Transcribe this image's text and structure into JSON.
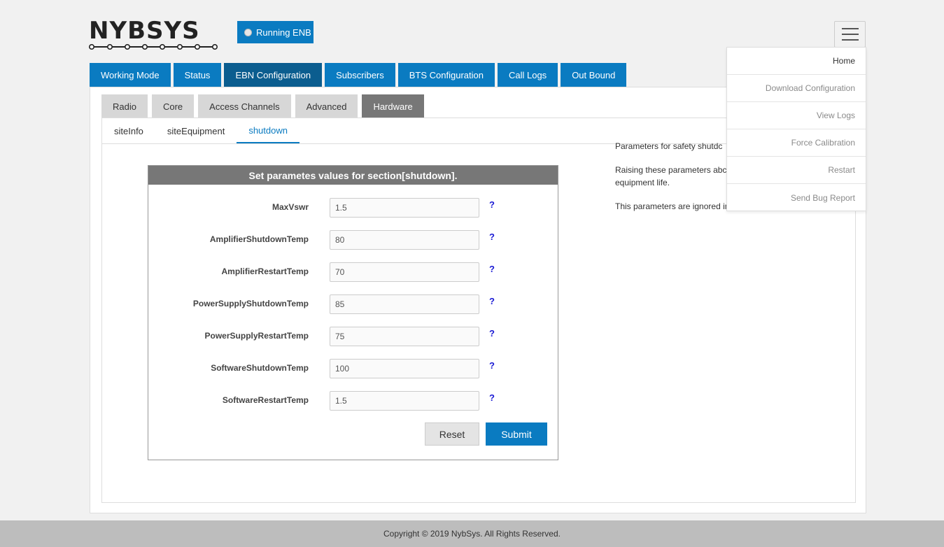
{
  "brand": {
    "logo_text": "NYBSYS"
  },
  "status": {
    "label": "Running ENB"
  },
  "main_tabs": [
    {
      "label": "Working Mode"
    },
    {
      "label": "Status"
    },
    {
      "label": "EBN Configuration"
    },
    {
      "label": "Subscribers"
    },
    {
      "label": "BTS Configuration"
    },
    {
      "label": "Call Logs"
    },
    {
      "label": "Out Bound"
    }
  ],
  "sub_tabs": [
    {
      "label": "Radio"
    },
    {
      "label": "Core"
    },
    {
      "label": "Access Channels"
    },
    {
      "label": "Advanced"
    },
    {
      "label": "Hardware"
    }
  ],
  "link_tabs": [
    {
      "label": "siteInfo"
    },
    {
      "label": "siteEquipment"
    },
    {
      "label": "shutdown"
    }
  ],
  "form": {
    "title": "Set parametes values for section[shutdown].",
    "fields": [
      {
        "label": "MaxVswr",
        "value": "1.5",
        "help": "?"
      },
      {
        "label": "AmplifierShutdownTemp",
        "value": "80",
        "help": "?"
      },
      {
        "label": "AmplifierRestartTemp",
        "value": "70",
        "help": "?"
      },
      {
        "label": "PowerSupplyShutdownTemp",
        "value": "85",
        "help": "?"
      },
      {
        "label": "PowerSupplyRestartTemp",
        "value": "75",
        "help": "?"
      },
      {
        "label": "SoftwareShutdownTemp",
        "value": "100",
        "help": "?"
      },
      {
        "label": "SoftwareRestartTemp",
        "value": "1.5",
        "help": "?"
      }
    ],
    "reset_label": "Reset",
    "submit_label": "Submit"
  },
  "description": {
    "p1": "Parameters for safety shutdc",
    "p2": "Raising these parameters abc result in damage to the eNoc equipment life.",
    "p3": "This parameters are ignored in labkit units"
  },
  "menu": {
    "items": [
      {
        "label": "Home"
      },
      {
        "label": "Download Configuration"
      },
      {
        "label": "View Logs"
      },
      {
        "label": "Force Calibration"
      },
      {
        "label": "Restart"
      },
      {
        "label": "Send Bug Report"
      }
    ]
  },
  "footer": {
    "text": "Copyright © 2019 NybSys. All Rights Reserved."
  }
}
